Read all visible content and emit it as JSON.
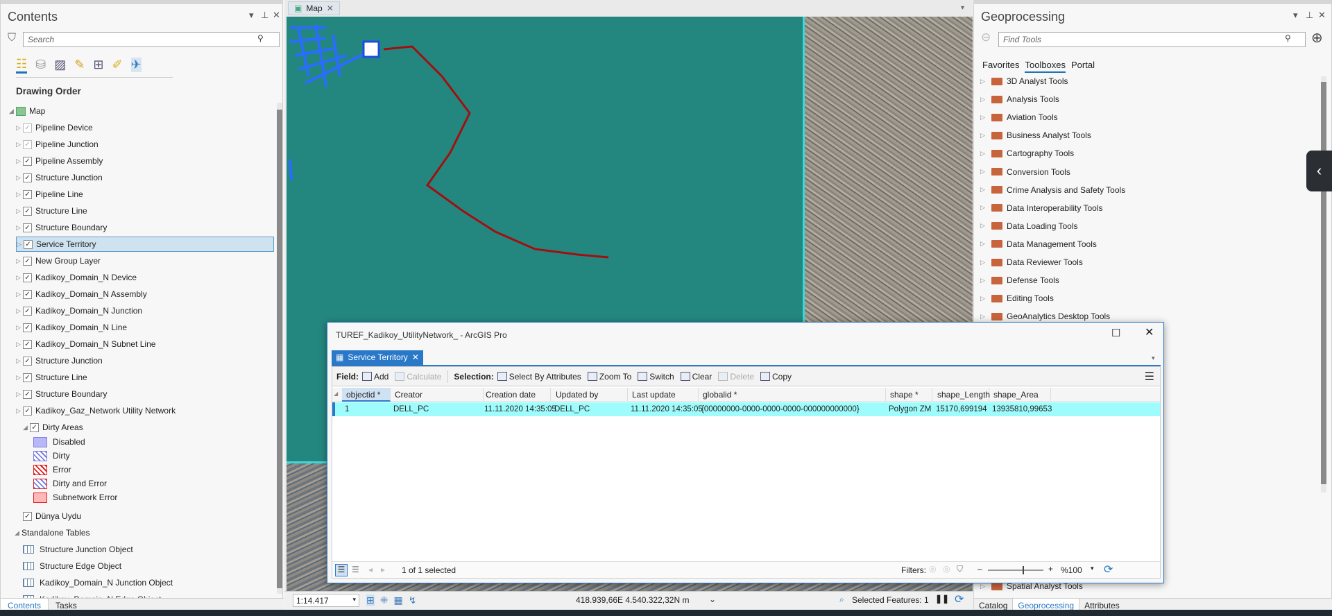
{
  "contents": {
    "title": "Contents",
    "search_placeholder": "Search",
    "drawing_order": "Drawing Order",
    "map_label": "Map",
    "layers": [
      {
        "label": "Pipeline Device",
        "dim": true
      },
      {
        "label": "Pipeline Junction",
        "dim": true
      },
      {
        "label": "Pipeline Assembly"
      },
      {
        "label": "Structure Junction"
      },
      {
        "label": "Pipeline Line"
      },
      {
        "label": "Structure Line"
      },
      {
        "label": "Structure Boundary"
      },
      {
        "label": "Service Territory",
        "selected": true
      },
      {
        "label": "New Group Layer"
      },
      {
        "label": "Kadikoy_Domain_N Device"
      },
      {
        "label": "Kadikoy_Domain_N Assembly"
      },
      {
        "label": "Kadikoy_Domain_N Junction"
      },
      {
        "label": "Kadikoy_Domain_N Line"
      },
      {
        "label": "Kadikoy_Domain_N Subnet Line"
      },
      {
        "label": "Structure Junction"
      },
      {
        "label": "Structure Line"
      },
      {
        "label": "Structure Boundary"
      },
      {
        "label": "Kadikoy_Gaz_Network Utility Network"
      }
    ],
    "dirty_areas": "Dirty Areas",
    "legend": [
      {
        "label": "Disabled",
        "fill": "#b8b8f8",
        "stroke": "#8080e0",
        "hatch": false
      },
      {
        "label": "Dirty",
        "fill": "#ffffff",
        "stroke": "#8080e0",
        "hatch": "#8080e0"
      },
      {
        "label": "Error",
        "fill": "#ffffff",
        "stroke": "#e02020",
        "hatch": "#e02020"
      },
      {
        "label": "Dirty and Error",
        "fill": "#ffffff",
        "stroke": "#e02020",
        "hatch": "#8080e0"
      },
      {
        "label": "Subnetwork Error",
        "fill": "#ffb8b8",
        "stroke": "#e02020",
        "hatch": false
      }
    ],
    "basemap": "Dünya Uydu",
    "standalone": "Standalone Tables",
    "tables": [
      "Structure Junction Object",
      "Structure Edge Object",
      "Kadikoy_Domain_N Junction Object",
      "Kadikoy_Domain_N Edge Object"
    ],
    "bottom_tabs": [
      "Contents",
      "Tasks"
    ]
  },
  "map": {
    "tab": "Map",
    "scale": "1:14.417",
    "coords": "418.939,66E 4.540.322,32N m",
    "selected_features": "Selected Features: 1",
    "line_color": "#a01010",
    "water_color": "#24877f"
  },
  "geoprocessing": {
    "title": "Geoprocessing",
    "search_placeholder": "Find Tools",
    "tabs": [
      "Favorites",
      "Toolboxes",
      "Portal"
    ],
    "tools": [
      "3D Analyst Tools",
      "Analysis Tools",
      "Aviation Tools",
      "Business Analyst Tools",
      "Cartography Tools",
      "Conversion Tools",
      "Crime Analysis and Safety Tools",
      "Data Interoperability Tools",
      "Data Loading Tools",
      "Data Management Tools",
      "Data Reviewer Tools",
      "Defense Tools",
      "Editing Tools",
      "GeoAnalytics Desktop Tools"
    ],
    "last_tool": "Spatial Analyst Tools",
    "bottom_tabs": [
      "Catalog",
      "Geoprocessing",
      "Attributes"
    ]
  },
  "dialog": {
    "title": "TUREF_Kadikoy_UtilityNetwork_ - ArcGIS Pro",
    "tab": "Service Territory",
    "field_label": "Field:",
    "add": "Add",
    "calculate": "Calculate",
    "selection_label": "Selection:",
    "select_by_attr": "Select By Attributes",
    "zoom_to": "Zoom To",
    "switch": "Switch",
    "clear": "Clear",
    "delete": "Delete",
    "copy": "Copy",
    "columns": [
      "objectid *",
      "Creator",
      "Creation date",
      "Updated by",
      "Last update",
      "globalid *",
      "shape *",
      "shape_Length",
      "shape_Area"
    ],
    "rows": [
      [
        "1",
        "DELL_PC",
        "11.11.2020 14:35:05",
        "DELL_PC",
        "11.11.2020 14:35:05",
        "{00000000-0000-0000-0000-000000000000}",
        "Polygon ZM",
        "15170,699194",
        "13935810,99653"
      ]
    ],
    "selected_text": "1 of 1 selected",
    "filters": "Filters:",
    "zoom": "%100"
  }
}
